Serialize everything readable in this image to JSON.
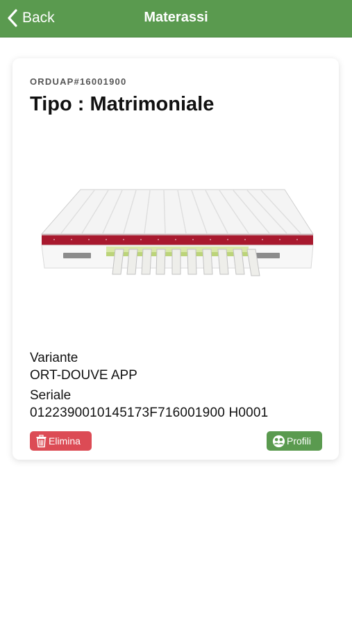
{
  "navbar": {
    "back_label": "Back",
    "title": "Materassi",
    "color": "#5a9a4f"
  },
  "card": {
    "order_code": "ORDUAP#16001900",
    "type_title": "Tipo : Matrimoniale",
    "image_icon": "mattress-image",
    "variant_label": "Variante",
    "variant_value": "ORT-DOUVE APP",
    "serial_label": "Seriale",
    "serial_value": "0122390010145173F716001900 H0001"
  },
  "actions": {
    "delete_label": "Elimina",
    "delete_icon": "trash-icon",
    "delete_color": "#dc4b55",
    "profiles_label": "Profili",
    "profiles_icon": "profiles-icon",
    "profiles_color": "#5a9a4f"
  }
}
